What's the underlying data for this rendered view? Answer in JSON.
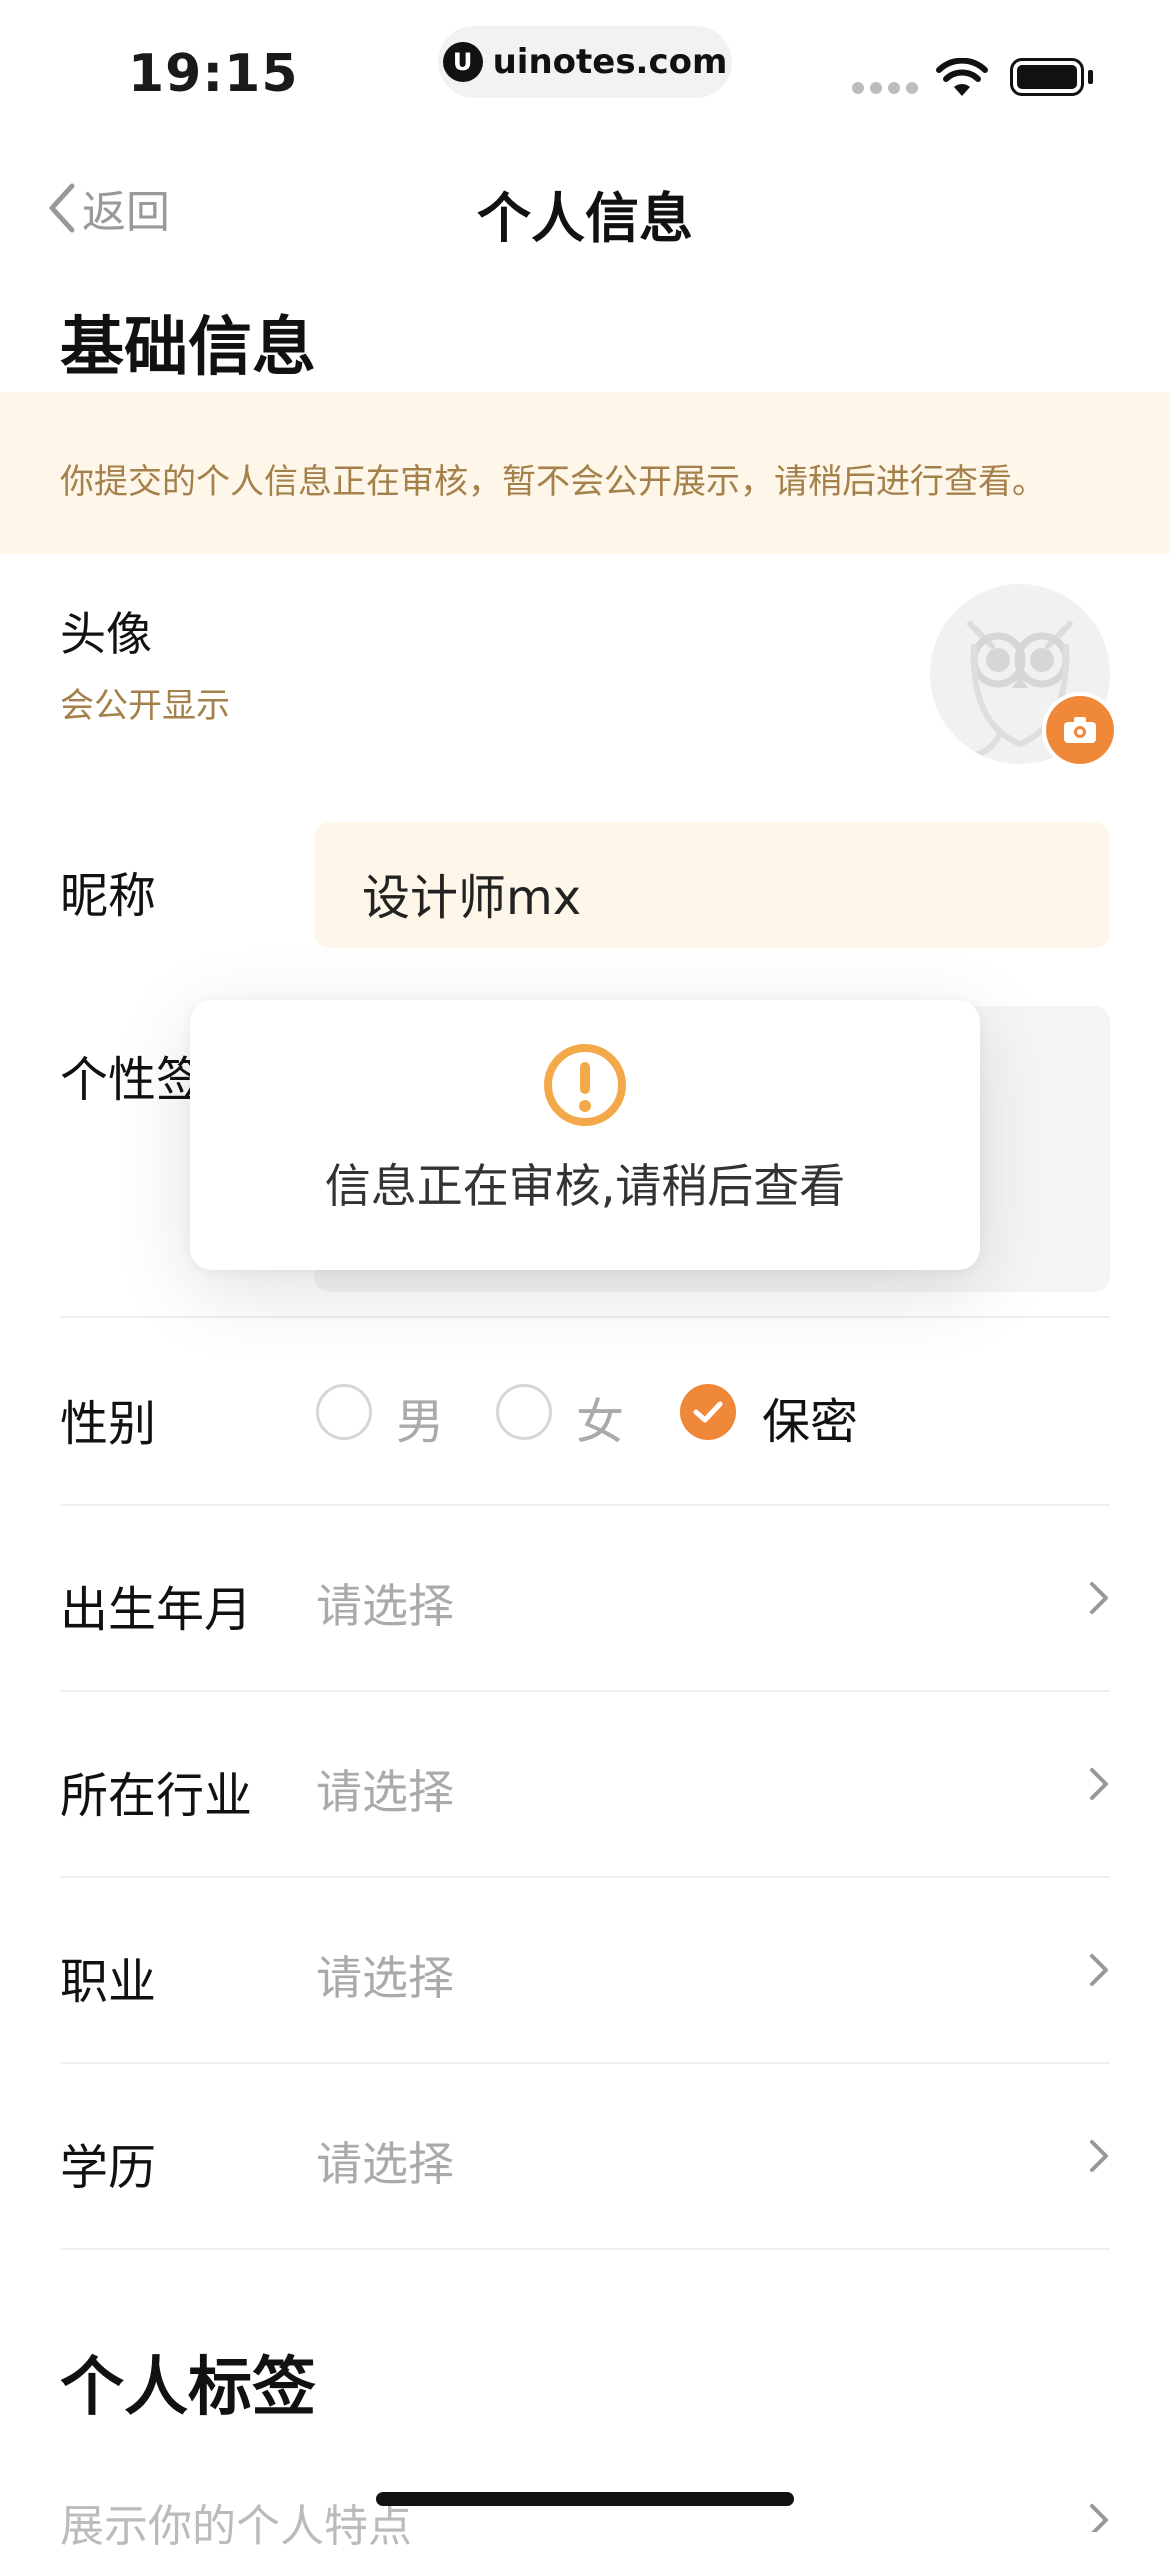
{
  "status_bar": {
    "time": "19:15",
    "url": "uinotes.com"
  },
  "nav": {
    "back_label": "返回",
    "title": "个人信息"
  },
  "basic_section": {
    "title": "基础信息",
    "notice": "你提交的个人信息正在审核，暂不会公开展示，请稍后进行查看。"
  },
  "avatar": {
    "label": "头像",
    "sublabel": "会公开显示"
  },
  "nickname": {
    "label": "昵称",
    "value": "设计师mx"
  },
  "signature": {
    "label": "个性签"
  },
  "gender": {
    "label": "性别",
    "options": [
      "男",
      "女",
      "保密"
    ],
    "selected": "保密"
  },
  "fields": [
    {
      "label": "出生年月",
      "placeholder": "请选择"
    },
    {
      "label": "所在行业",
      "placeholder": "请选择"
    },
    {
      "label": "职业",
      "placeholder": "请选择"
    },
    {
      "label": "学历",
      "placeholder": "请选择"
    }
  ],
  "tags_section": {
    "title": "个人标签",
    "hint": "展示你的个人特点"
  },
  "toast": {
    "message": "信息正在审核,请稍后查看"
  },
  "colors": {
    "accent": "#f0883a",
    "notice_bg": "#fdf6e9",
    "notice_text": "#a4804a",
    "warning_icon": "#f3a94a"
  }
}
